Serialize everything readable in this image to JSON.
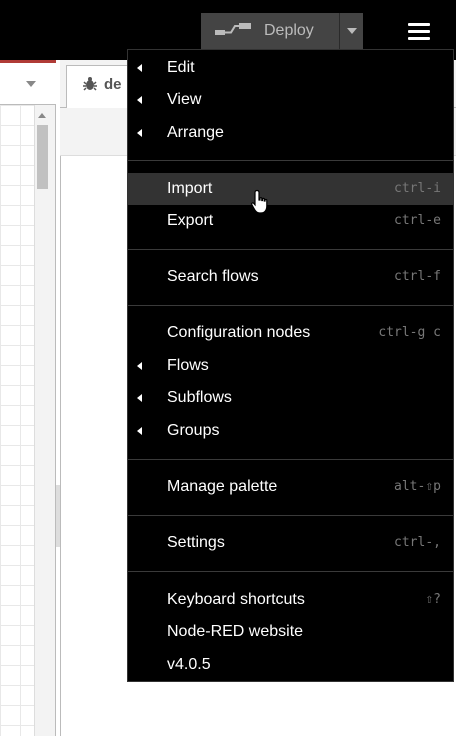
{
  "header": {
    "deploy_label": "Deploy",
    "deploy_icon": "deploy-icon",
    "menu_icon": "hamburger-menu-icon"
  },
  "workspace": {
    "tab_dropdown_icon": "chevron-down-icon"
  },
  "sidebar": {
    "debug_tab_label": "de",
    "debug_tab_icon": "bug-icon"
  },
  "menu": {
    "items": [
      {
        "label": "Edit",
        "shortcut": "",
        "submenu": true
      },
      {
        "label": "View",
        "shortcut": "",
        "submenu": true
      },
      {
        "label": "Arrange",
        "shortcut": "",
        "submenu": true
      },
      {
        "label": "Import",
        "shortcut": "ctrl-i",
        "submenu": false
      },
      {
        "label": "Export",
        "shortcut": "ctrl-e",
        "submenu": false
      },
      {
        "label": "Search flows",
        "shortcut": "ctrl-f",
        "submenu": false
      },
      {
        "label": "Configuration nodes",
        "shortcut": "ctrl-g c",
        "submenu": false
      },
      {
        "label": "Flows",
        "shortcut": "",
        "submenu": true
      },
      {
        "label": "Subflows",
        "shortcut": "",
        "submenu": true
      },
      {
        "label": "Groups",
        "shortcut": "",
        "submenu": true
      },
      {
        "label": "Manage palette",
        "shortcut": "alt-⇧p",
        "submenu": false
      },
      {
        "label": "Settings",
        "shortcut": "ctrl-,",
        "submenu": false
      },
      {
        "label": "Keyboard shortcuts",
        "shortcut": "⇧?",
        "submenu": false
      },
      {
        "label": "Node-RED website",
        "shortcut": "",
        "submenu": false
      },
      {
        "label": "v4.0.5",
        "shortcut": "",
        "submenu": false
      }
    ],
    "hovered_item": "Import"
  },
  "colors": {
    "header_bg": "#000000",
    "menu_bg": "#000000",
    "menu_hover": "#333333",
    "accent_red": "#b03b36"
  }
}
